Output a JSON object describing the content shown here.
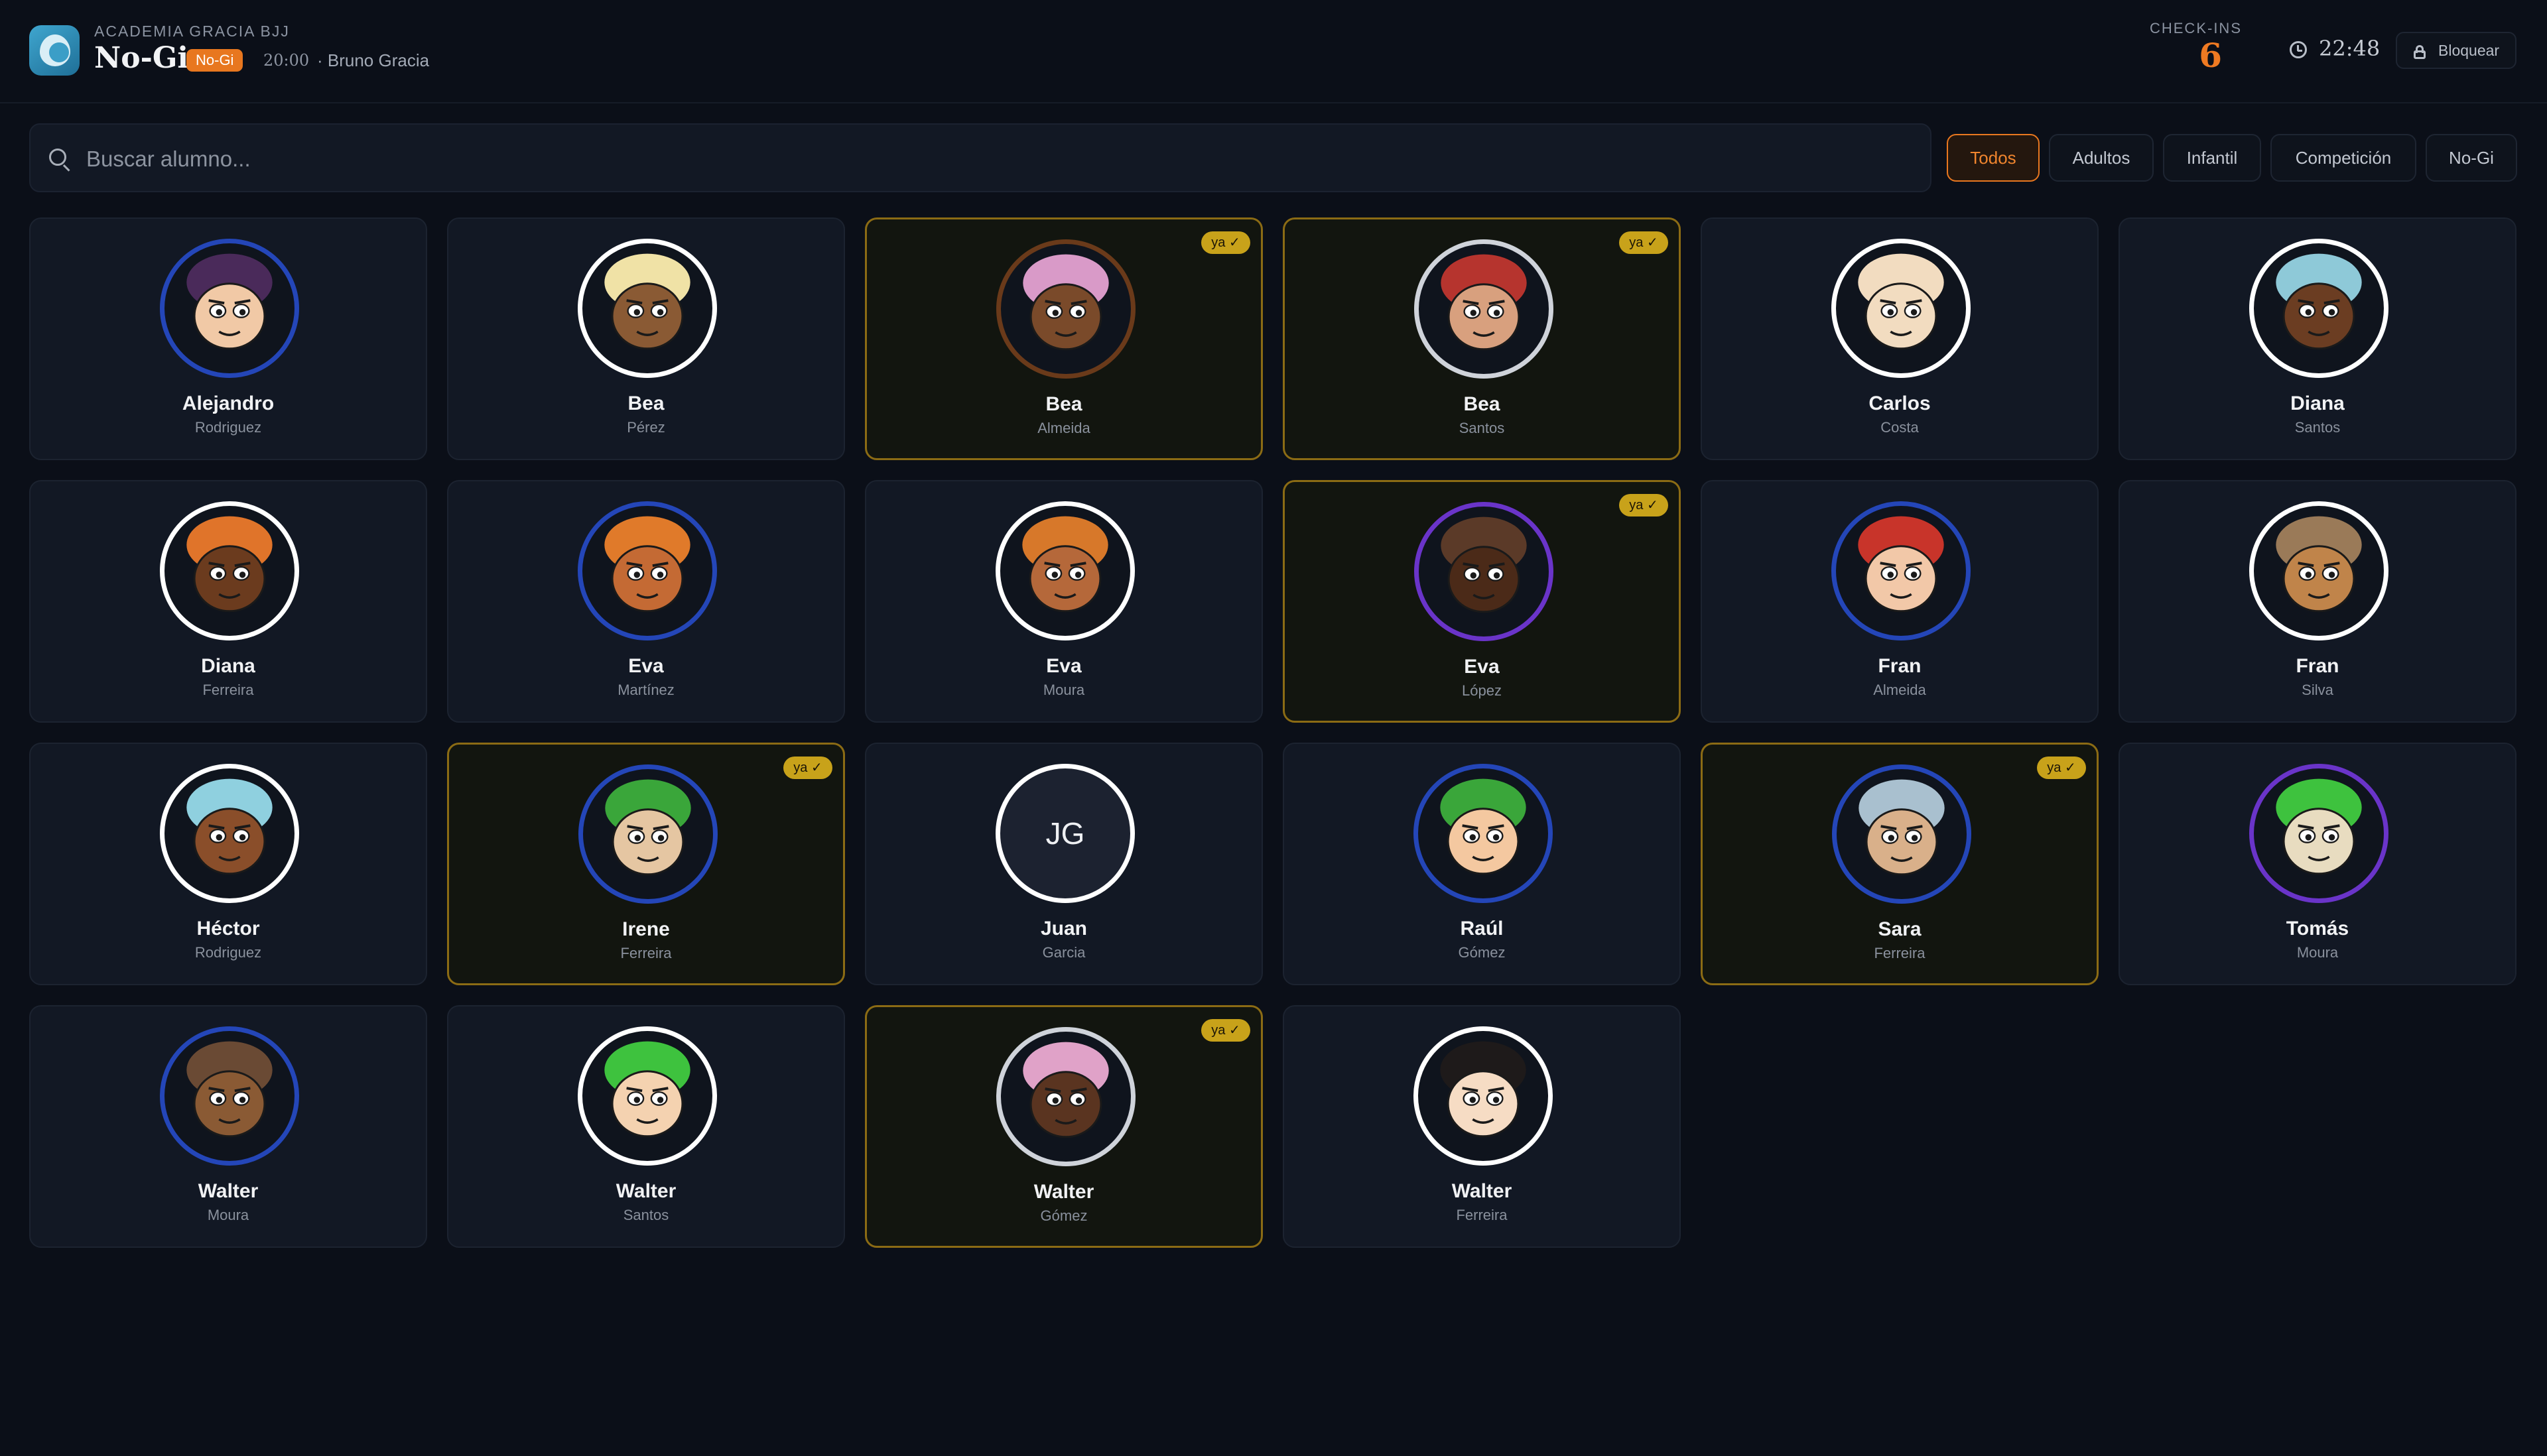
{
  "header": {
    "academy": "ACADEMIA GRACIA BJJ",
    "class_title": "No-Gi",
    "class_badge": "No-Gi",
    "class_time": "20:00",
    "instructor": "· Bruno Gracia",
    "checkins_label": "CHECK-INS",
    "checkins_count": "6",
    "clock": "22:48",
    "lock_label": "Bloquear"
  },
  "search": {
    "placeholder": "Buscar alumno..."
  },
  "filters": [
    "Todos",
    "Adultos",
    "Infantil",
    "Competición",
    "No-Gi"
  ],
  "active_filter": "Todos",
  "checked_badge": "ya ✓",
  "colors": {
    "accent": "#e8771f",
    "checked_border": "#8b6b14",
    "badge_gold": "#c8a21a",
    "ring_white": "#ffffff",
    "ring_blue": "#2446b8",
    "ring_purple": "#6a34c9",
    "ring_brown": "#6a3a1a",
    "ring_silver": "#cfd3da"
  },
  "students": [
    {
      "name": "Alejandro",
      "surname": "Rodriguez",
      "ring": "blue",
      "checked": false,
      "avatar": "cartoon-avatar"
    },
    {
      "name": "Bea",
      "surname": "Pérez",
      "ring": "white",
      "checked": false,
      "avatar": "cartoon-avatar"
    },
    {
      "name": "Bea",
      "surname": "Almeida",
      "ring": "brown",
      "checked": true,
      "avatar": "cartoon-avatar"
    },
    {
      "name": "Bea",
      "surname": "Santos",
      "ring": "silver",
      "checked": true,
      "avatar": "cartoon-avatar"
    },
    {
      "name": "Carlos",
      "surname": "Costa",
      "ring": "white",
      "checked": false,
      "avatar": "cartoon-avatar"
    },
    {
      "name": "Diana",
      "surname": "Santos",
      "ring": "white",
      "checked": false,
      "avatar": "cartoon-avatar"
    },
    {
      "name": "Diana",
      "surname": "Ferreira",
      "ring": "white",
      "checked": false,
      "avatar": "cartoon-avatar"
    },
    {
      "name": "Eva",
      "surname": "Martínez",
      "ring": "blue",
      "checked": false,
      "avatar": "cartoon-avatar"
    },
    {
      "name": "Eva",
      "surname": "Moura",
      "ring": "white",
      "checked": false,
      "avatar": "cartoon-avatar"
    },
    {
      "name": "Eva",
      "surname": "López",
      "ring": "purple",
      "checked": true,
      "avatar": "cartoon-avatar"
    },
    {
      "name": "Fran",
      "surname": "Almeida",
      "ring": "blue",
      "checked": false,
      "avatar": "cartoon-avatar"
    },
    {
      "name": "Fran",
      "surname": "Silva",
      "ring": "white",
      "checked": false,
      "avatar": "cartoon-avatar"
    },
    {
      "name": "Héctor",
      "surname": "Rodriguez",
      "ring": "white",
      "checked": false,
      "avatar": "cartoon-avatar"
    },
    {
      "name": "Irene",
      "surname": "Ferreira",
      "ring": "blue",
      "checked": true,
      "avatar": "cartoon-avatar"
    },
    {
      "name": "Juan",
      "surname": "Garcia",
      "ring": "white",
      "checked": false,
      "avatar": "initials",
      "initials": "JG"
    },
    {
      "name": "Raúl",
      "surname": "Gómez",
      "ring": "blue",
      "checked": false,
      "avatar": "cartoon-avatar"
    },
    {
      "name": "Sara",
      "surname": "Ferreira",
      "ring": "blue",
      "checked": true,
      "avatar": "cartoon-avatar"
    },
    {
      "name": "Tomás",
      "surname": "Moura",
      "ring": "purple",
      "checked": false,
      "avatar": "cartoon-avatar"
    },
    {
      "name": "Walter",
      "surname": "Moura",
      "ring": "blue",
      "checked": false,
      "avatar": "cartoon-avatar"
    },
    {
      "name": "Walter",
      "surname": "Santos",
      "ring": "white",
      "checked": false,
      "avatar": "cartoon-avatar"
    },
    {
      "name": "Walter",
      "surname": "Gómez",
      "ring": "silver",
      "checked": true,
      "avatar": "cartoon-avatar"
    },
    {
      "name": "Walter",
      "surname": "Ferreira",
      "ring": "white",
      "checked": false,
      "avatar": "cartoon-avatar"
    }
  ]
}
